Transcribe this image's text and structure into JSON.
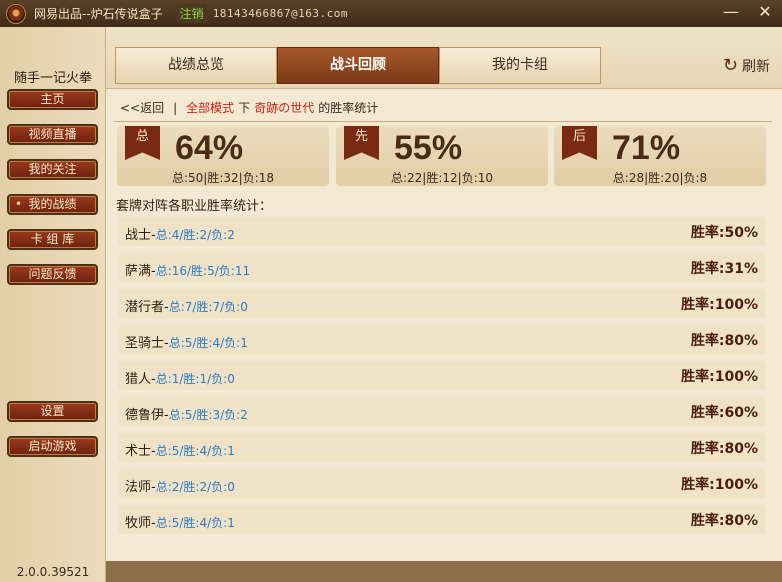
{
  "titlebar": {
    "title": "网易出品--炉石传说盒子",
    "logout": "注销",
    "email": "18143466867@163.com",
    "minimize": "—",
    "close": "✕"
  },
  "sidebar": {
    "user": "随手一记火拳",
    "items": [
      {
        "label": "主页"
      },
      {
        "label": "视频直播"
      },
      {
        "label": "我的关注"
      },
      {
        "label": "我的战绩"
      },
      {
        "label": "卡 组 库"
      },
      {
        "label": "问题反馈"
      },
      {
        "label": "设置"
      },
      {
        "label": "启动游戏"
      }
    ],
    "version": "2.0.0.39521"
  },
  "tabs": [
    {
      "label": "战绩总览"
    },
    {
      "label": "战斗回顾"
    },
    {
      "label": "我的卡组"
    }
  ],
  "refresh_label": "刷新",
  "breadcrumb": {
    "back": "<<返回",
    "sep": "|",
    "mode": "全部模式",
    "mid": "下",
    "deck": "奇跡の世代",
    "tail": "的胜率统计"
  },
  "stats": [
    {
      "flag": "总",
      "pct": "64%",
      "sub": "总:50|胜:32|负:18"
    },
    {
      "flag": "先",
      "pct": "55%",
      "sub": "总:22|胜:12|负:10"
    },
    {
      "flag": "后",
      "pct": "71%",
      "sub": "总:28|胜:20|负:8"
    }
  ],
  "section_title": "套牌对阵各职业胜率统计：",
  "rows": [
    {
      "name": "战士-",
      "detail": "总:4/胜:2/负:2",
      "rate": "胜率:50%"
    },
    {
      "name": "萨满-",
      "detail": "总:16/胜:5/负:11",
      "rate": "胜率:31%"
    },
    {
      "name": "潜行者-",
      "detail": "总:7/胜:7/负:0",
      "rate": "胜率:100%"
    },
    {
      "name": "圣骑士-",
      "detail": "总:5/胜:4/负:1",
      "rate": "胜率:80%"
    },
    {
      "name": "猎人-",
      "detail": "总:1/胜:1/负:0",
      "rate": "胜率:100%"
    },
    {
      "name": "德鲁伊-",
      "detail": "总:5/胜:3/负:2",
      "rate": "胜率:60%"
    },
    {
      "name": "术士-",
      "detail": "总:5/胜:4/负:1",
      "rate": "胜率:80%"
    },
    {
      "name": "法师-",
      "detail": "总:2/胜:2/负:0",
      "rate": "胜率:100%"
    },
    {
      "name": "牧师-",
      "detail": "总:5/胜:4/负:1",
      "rate": "胜率:80%"
    }
  ]
}
